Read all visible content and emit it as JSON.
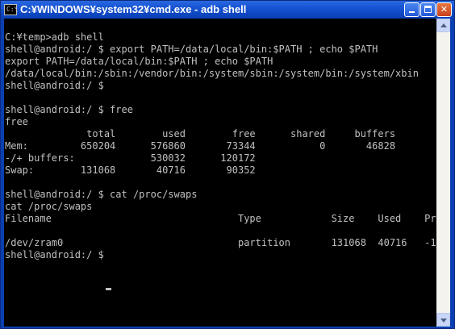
{
  "window": {
    "icon_text": "C:\\",
    "title": "C:¥WINDOWS¥system32¥cmd.exe - adb shell"
  },
  "console": {
    "text": "C:¥temp>adb shell\nshell@android:/ $ export PATH=/data/local/bin:$PATH ; echo $PATH\nexport PATH=/data/local/bin:$PATH ; echo $PATH\n/data/local/bin:/sbin:/vendor/bin:/system/sbin:/system/bin:/system/xbin\nshell@android:/ $\n\nshell@android:/ $ free\nfree\n              total        used        free      shared     buffers\nMem:         650204      576860       73344           0       46828\n-/+ buffers:             530032      120172\nSwap:        131068       40716       90352\n\nshell@android:/ $ cat /proc/swaps\ncat /proc/swaps\nFilename                                Type            Size    Used    Priority\n\n/dev/zram0                              partition       131068  40716   -1\nshell@android:/ $ "
  },
  "colors": {
    "titlebar": "#0f48c4",
    "console_bg": "#000000",
    "console_fg": "#c0c0c0",
    "close_button": "#c9411f"
  }
}
